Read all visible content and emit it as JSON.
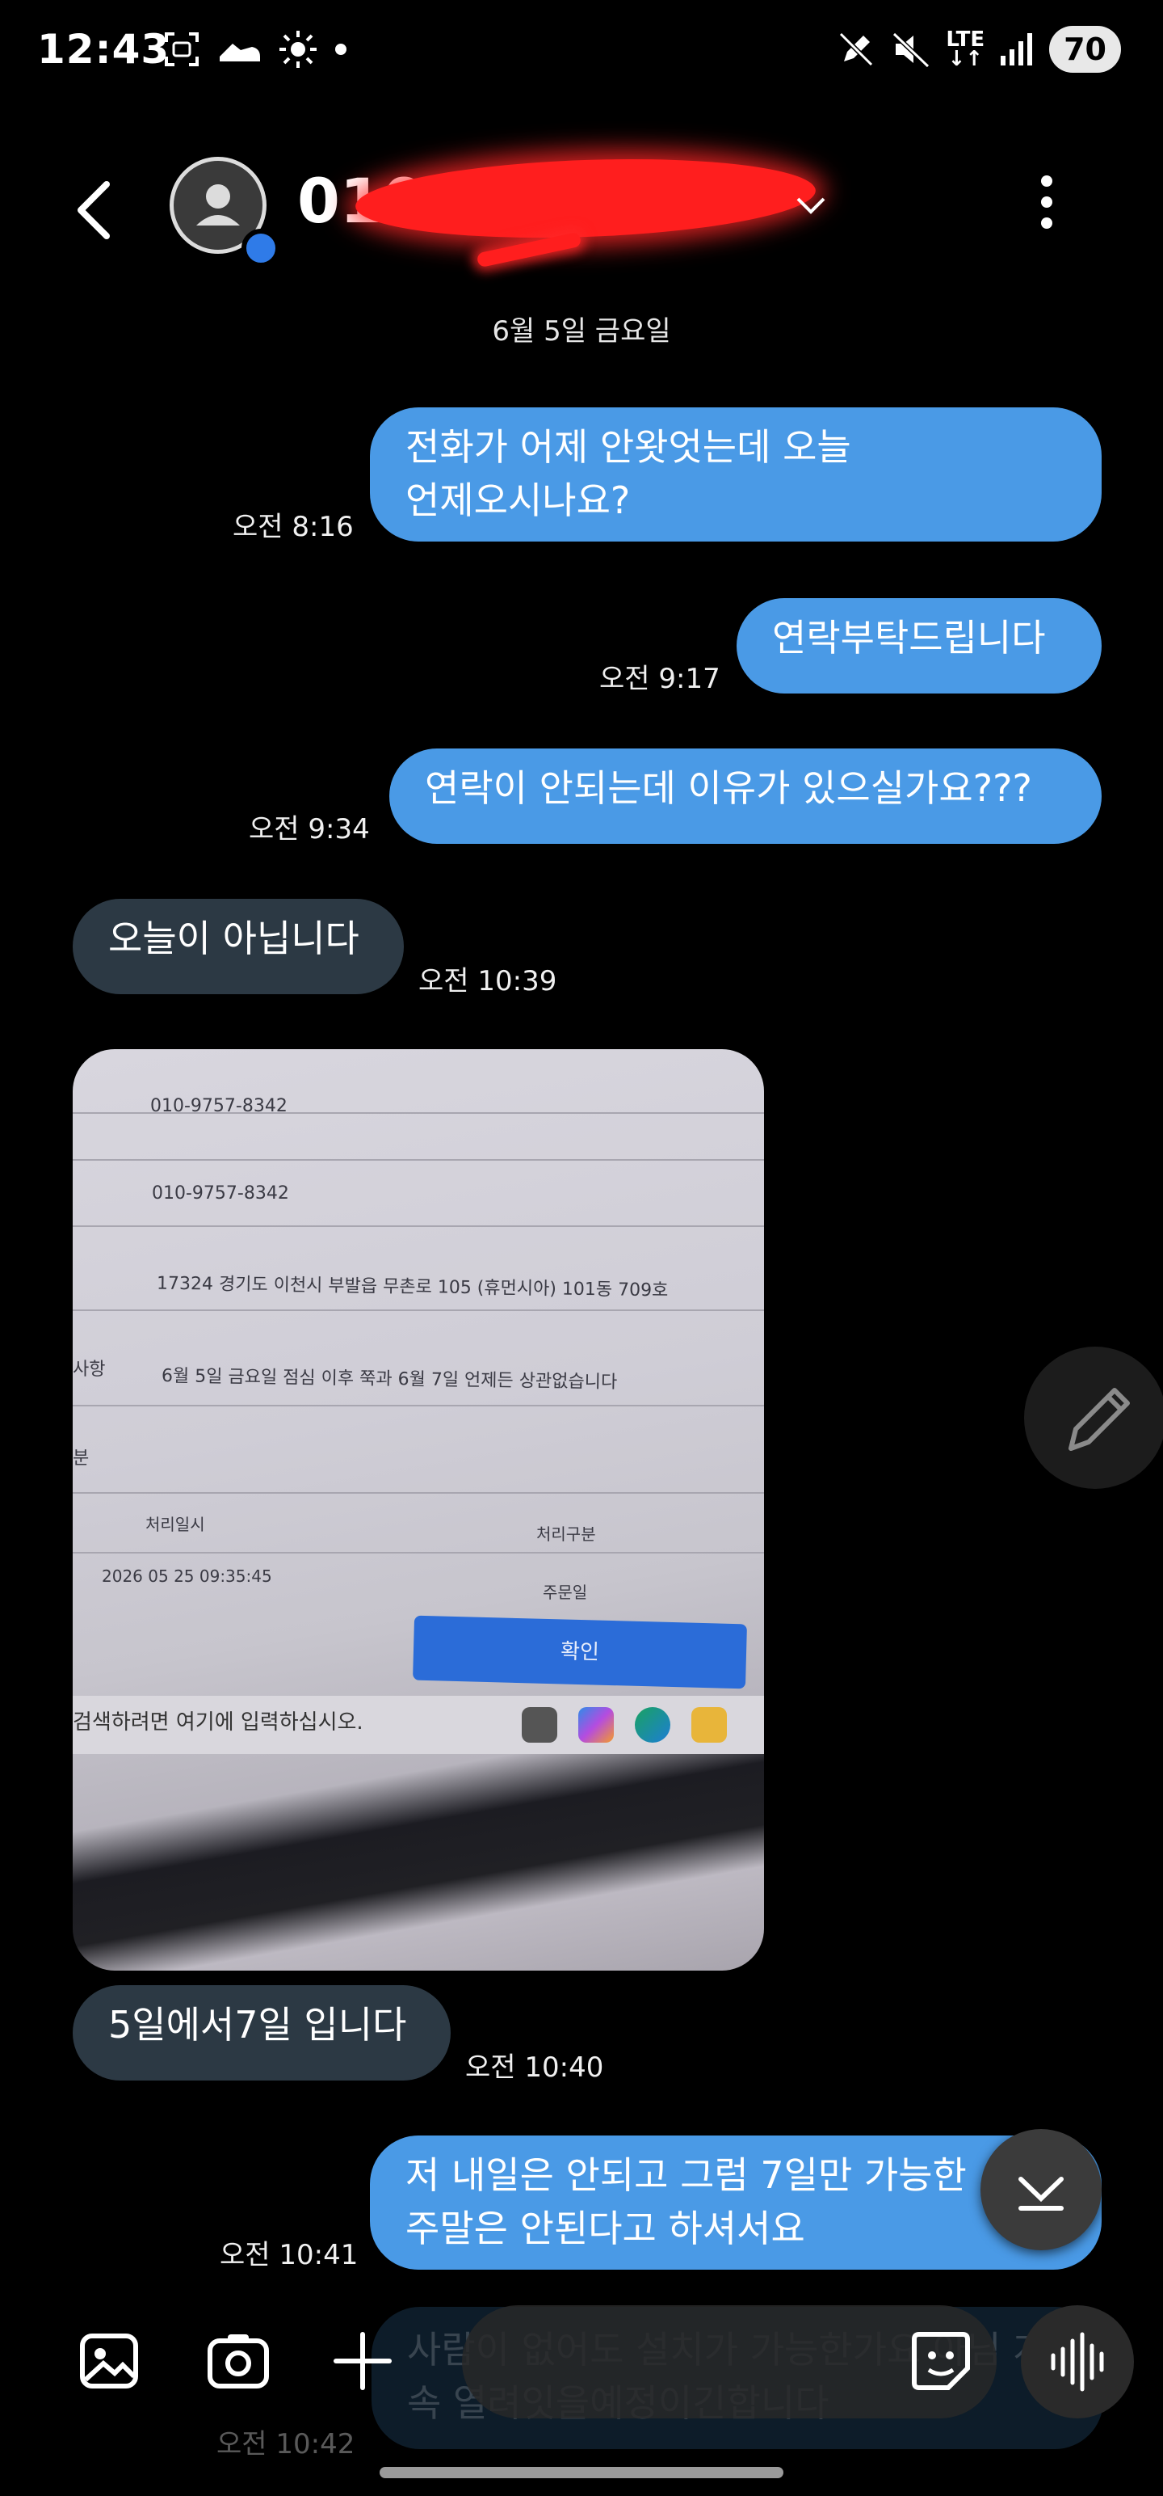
{
  "status_bar": {
    "time": "12:43",
    "network": "LTE",
    "battery": "70"
  },
  "header": {
    "contact_name": "010"
  },
  "date_divider": "6월 5일 금요일",
  "messages": [
    {
      "type": "sent",
      "text": "전화가 어제 안왓엇는데 오늘\n언제오시나요?",
      "time": "오전 8:16"
    },
    {
      "type": "sent",
      "text": "연락부탁드립니다",
      "time": "오전 9:17"
    },
    {
      "type": "sent",
      "text": "연락이 안되는데 이유가 있으실가요???",
      "time": "오전 9:34"
    },
    {
      "type": "received",
      "text": "오늘이 아닙니다",
      "time": "오전 10:39"
    },
    {
      "type": "received",
      "text": "5일에서7일 입니다",
      "time": "오전 10:40"
    },
    {
      "type": "sent",
      "text": "저 내일은 안되고 그럼 7일만 가능한\n주말은 안된다고 하셔서요",
      "time": "오전 10:41"
    }
  ],
  "photo": {
    "line1": "010-9757-8342",
    "line2": "010-9757-8342",
    "address": "17324 경기도 이천시 부발읍 무촌로 105 (휴먼시아) 101동 709호",
    "memo_label": "사항",
    "memo": "6월 5일 금요일 점심 이후 쭉과 6월 7일 언제든 상관없습니다",
    "section_label": "분",
    "col1": "처리일시",
    "col2": "처리구분",
    "row_date": "2026 05 25 09:35:45",
    "row_type": "주문일",
    "confirm_button": "확인",
    "taskbar_search": "검색하려면 여기에 입력하십시오."
  },
  "composer": {
    "ghost_text": "사람이 없어도 설치가 가능한가요 아님 계속 열려잇을예정이긴합니다",
    "ghost_time": "오전 10:42"
  },
  "colors": {
    "sent_bubble": "#4a9ae6",
    "received_bubble": "#2c3944",
    "background": "#000000"
  }
}
